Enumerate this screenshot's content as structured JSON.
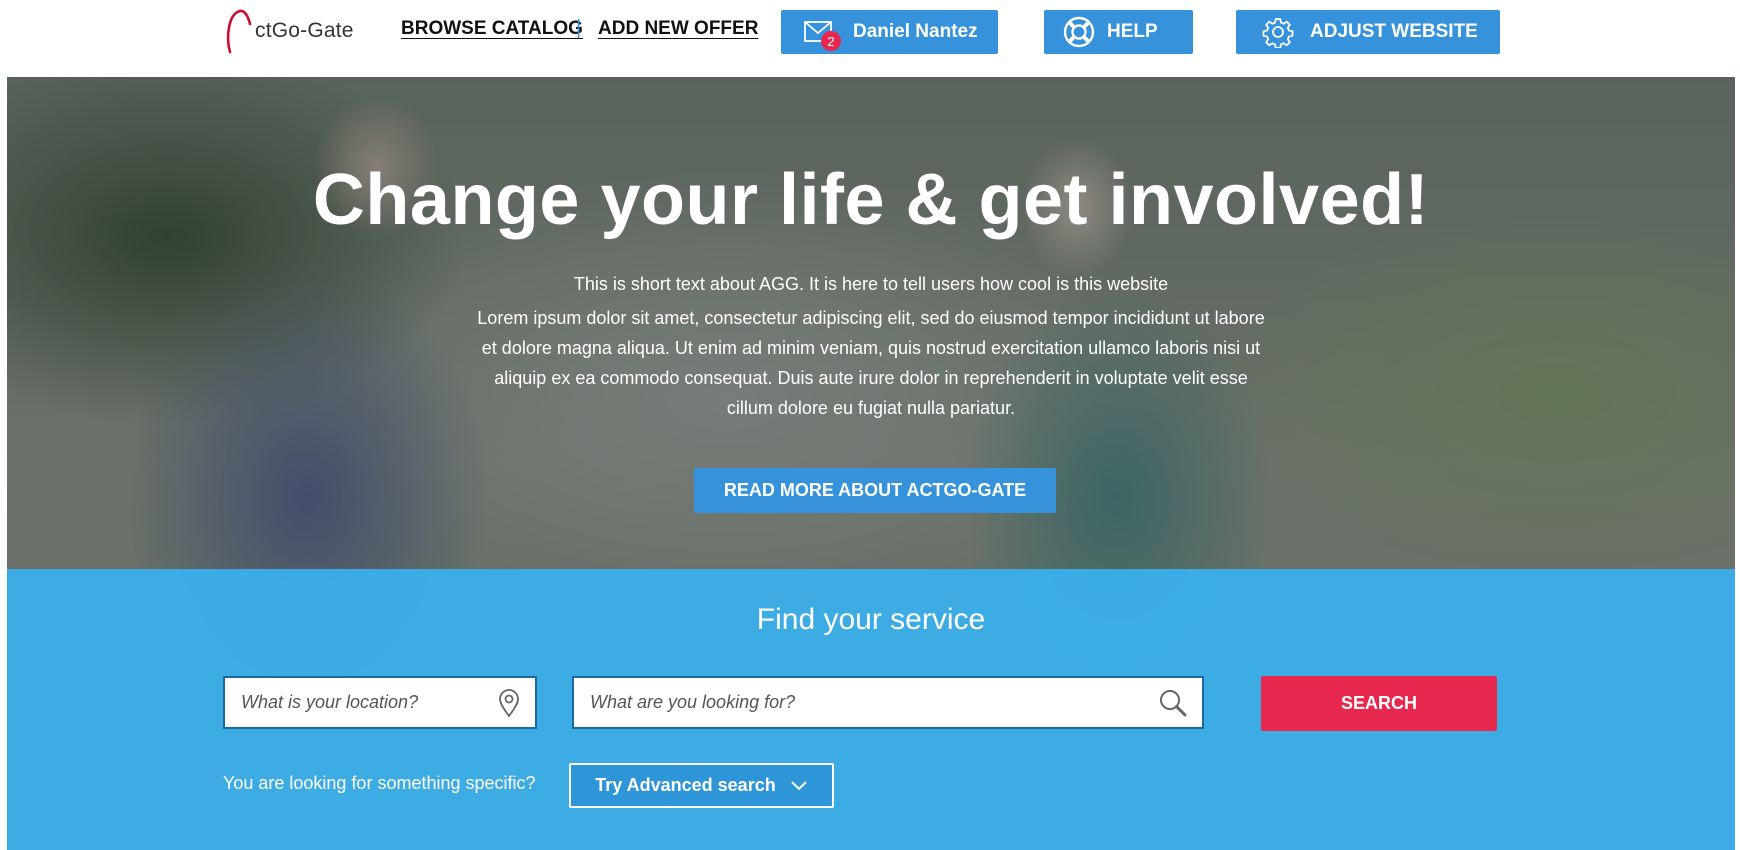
{
  "header": {
    "logo_text": "ctGo-Gate",
    "nav": {
      "browse_catalog": "BROWSE CATALOG",
      "separator": "|",
      "add_new_offer": "ADD NEW OFFER"
    },
    "user_button": {
      "name": "Daniel Nantez",
      "unread_count": "2",
      "icon": "mail-icon"
    },
    "help_button": {
      "label": "HELP",
      "icon": "lifebuoy-icon"
    },
    "adjust_button": {
      "label": "ADJUST WEBSITE",
      "icon": "gear-icon"
    }
  },
  "hero": {
    "title": "Change your life & get involved!",
    "lead": "This is short text about AGG. It is here to tell users how cool is this website",
    "paragraph": "Lorem ipsum dolor sit amet, consectetur adipiscing elit, sed do eiusmod tempor incididunt ut labore et dolore magna aliqua. Ut enim ad minim veniam, quis nostrud exercitation ullamco laboris nisi ut aliquip ex ea commodo consequat. Duis aute irure dolor in reprehenderit in voluptate velit esse cillum dolore eu fugiat nulla pariatur.",
    "read_more_label": "READ MORE ABOUT ACTGO-GATE"
  },
  "search": {
    "title": "Find your service",
    "location_placeholder": "What is your location?",
    "query_placeholder": "What are you looking for?",
    "search_label": "SEARCH",
    "specific_text": "You are looking for something specific?",
    "advanced_label": "Try Advanced search"
  },
  "colors": {
    "primary_blue": "#3592db",
    "search_panel": "#3ab0ee",
    "search_red": "#e8274f",
    "logo_red": "#c8102e"
  }
}
